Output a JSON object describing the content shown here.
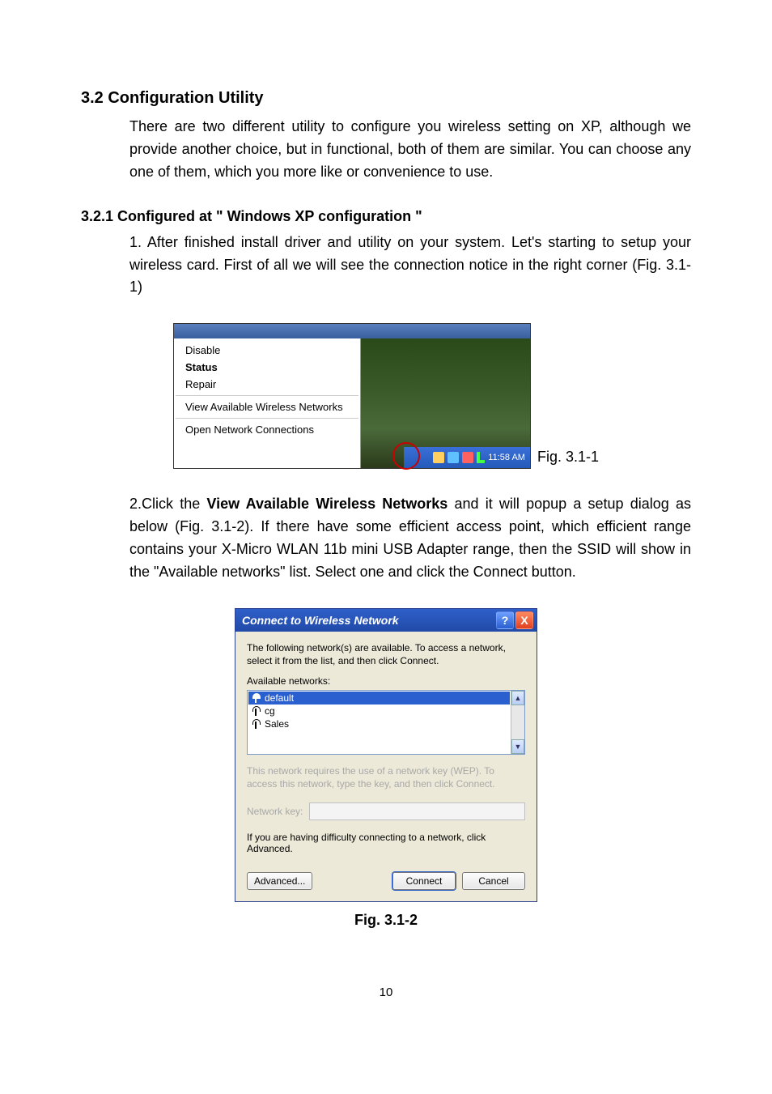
{
  "headings": {
    "section": "3.2 Configuration Utility",
    "subsection": "3.2.1 Configured at \" Windows XP configuration \""
  },
  "paragraphs": {
    "p1": "There are two different utility to configure you wireless setting on XP, although we provide another choice, but in functional, both of them are similar. You can choose any one of them, which you more like or convenience to use.",
    "p2": "1. After finished install driver and utility on your system. Let's starting to setup your wireless card. First of all we will see the connection notice in the right corner (Fig. 3.1-1)",
    "p3a": "2.Click the ",
    "p3b_bold": "View Available Wireless Networks",
    "p3c": " and it will popup a setup dialog as below (Fig. 3.1-2). If there have some efficient access point, which efficient range contains your X-Micro WLAN 11b mini USB Adapter range, then the SSID will show in the \"Available networks\" list. Select one and click the Connect button."
  },
  "fig311": {
    "menu": {
      "disable": "Disable",
      "status": "Status",
      "repair": "Repair",
      "view": "View Available Wireless Networks",
      "open": "Open Network Connections"
    },
    "clock": "11:58 AM",
    "caption": "Fig. 3.1-1"
  },
  "fig312": {
    "title": "Connect to Wireless Network",
    "help_glyph": "?",
    "close_glyph": "X",
    "instr": "The following network(s) are available. To access a network, select it from the list, and then click Connect.",
    "avail_label": "Available networks:",
    "networks": {
      "n0": "default",
      "n1": "cg",
      "n2": "Sales"
    },
    "wep_note": "This network requires the use of a network key (WEP). To access this network, type the key, and then click Connect.",
    "network_key_label": "Network key:",
    "difficulty": "If you are having difficulty connecting to a network, click Advanced.",
    "btn_advanced": "Advanced...",
    "btn_connect": "Connect",
    "btn_cancel": "Cancel",
    "caption": "Fig. 3.1-2"
  },
  "page_number": "10"
}
